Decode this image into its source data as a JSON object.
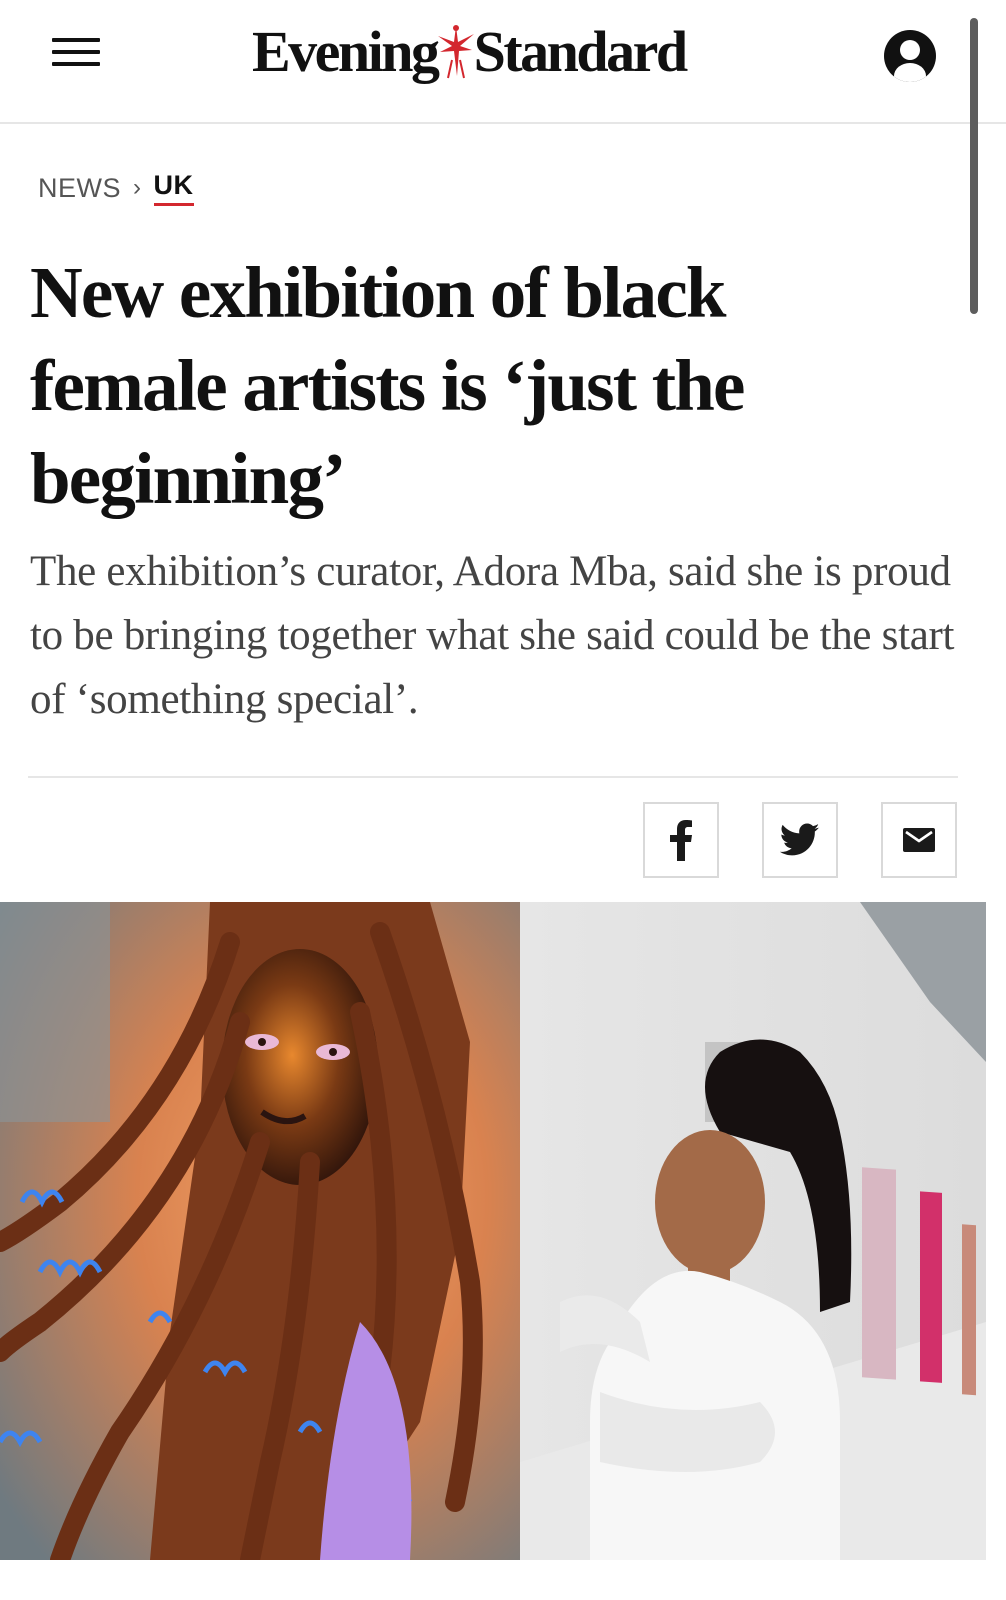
{
  "header": {
    "logo_left": "Evening",
    "logo_right": "Standard",
    "menu_icon": "hamburger-menu-icon",
    "account_icon": "account-icon"
  },
  "breadcrumb": {
    "section": "NEWS",
    "separator": "›",
    "subsection": "UK"
  },
  "article": {
    "headline": "New exhibition of black female artists is ‘just the beginning’",
    "standfirst": "The exhibition’s curator, Adora Mba, said she is proud to be bringing together what she said could be the start of ‘something special’."
  },
  "share": {
    "facebook_icon": "facebook-icon",
    "twitter_icon": "twitter-icon",
    "email_icon": "email-icon"
  },
  "colors": {
    "accent_red": "#d3272e",
    "text_dark": "#111111",
    "text_grey": "#444444",
    "rule": "#e6e6e6"
  }
}
